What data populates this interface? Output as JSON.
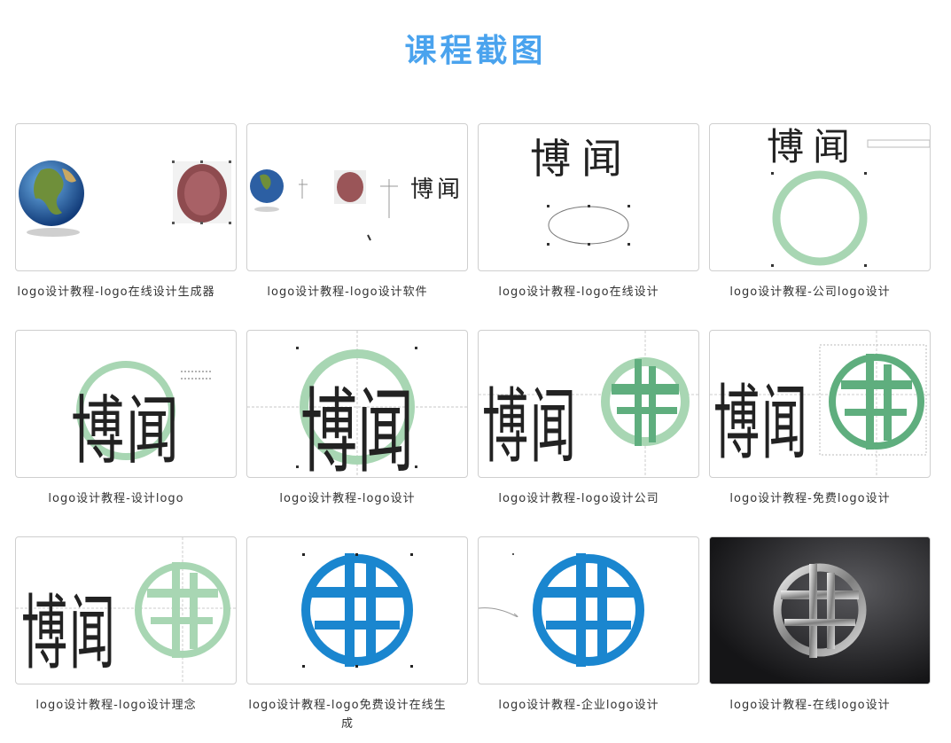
{
  "page": {
    "title": "课程截图"
  },
  "logo_chars": {
    "bo": "博",
    "wen": "闻"
  },
  "screenshots": [
    {
      "caption": "logo设计教程-logo在线设计生成器",
      "icon": "earth-globe-and-seal-icon"
    },
    {
      "caption": "logo设计教程-logo设计软件",
      "icon": "globe-seal-text-icon"
    },
    {
      "caption": "logo设计教程-logo在线设计",
      "icon": "text-ellipse-icon"
    },
    {
      "caption": "logo设计教程-公司logo设计",
      "icon": "text-ring-icon"
    },
    {
      "caption": "logo设计教程-设计logo",
      "icon": "text-on-ring-icon"
    },
    {
      "caption": "logo设计教程-logo设计",
      "icon": "text-on-ring-guides-icon"
    },
    {
      "caption": "logo设计教程-logo设计公司",
      "icon": "text-and-green-emblem-icon"
    },
    {
      "caption": "logo设计教程-免费logo设计",
      "icon": "text-and-green-emblem-guides-icon"
    },
    {
      "caption": "logo设计教程-logo设计理念",
      "icon": "text-and-light-emblem-icon"
    },
    {
      "caption": "logo设计教程-logo免费设计在线生成",
      "icon": "blue-emblem-selected-icon"
    },
    {
      "caption": "logo设计教程-企业logo设计",
      "icon": "blue-emblem-icon"
    },
    {
      "caption": "logo设计教程-在线logo设计",
      "icon": "metal-emblem-dark-icon"
    }
  ],
  "colors": {
    "title": "#4aa3ee",
    "green": "#5fae7e",
    "light_green": "#a8d6b3",
    "blue": "#1a86cf",
    "dark_bg": "#1d1d1f"
  }
}
